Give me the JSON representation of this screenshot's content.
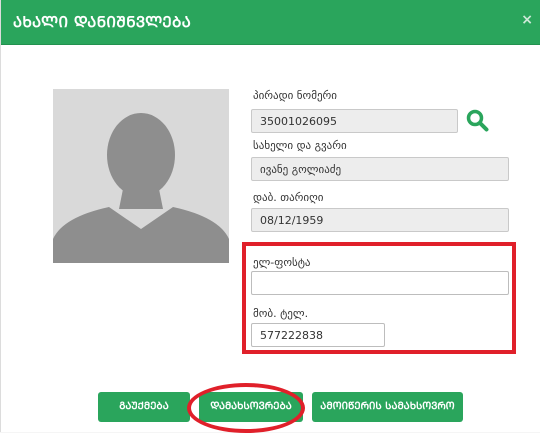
{
  "dialog": {
    "title": "ᲐᲮᲐᲚᲘ ᲓᲐᲜᲘᲨᲜᲕᲚᲔᲑᲐ",
    "close_icon": "×"
  },
  "fields": {
    "personal_number": {
      "label": "პირადი ნომერი",
      "value": "35001026095"
    },
    "full_name": {
      "label": "სახელი და გვარი",
      "value": "ივანე გოლიაძე"
    },
    "birth_date": {
      "label": "დაბ. თარიღი",
      "value": "08/12/1959"
    },
    "email": {
      "label": "ელ-ფოსტა",
      "value": ""
    },
    "mobile": {
      "label": "მობ. ტელ.",
      "value": "577222838"
    }
  },
  "buttons": {
    "cancel": "ᲒᲐᲣᲥᲛᲔᲑᲐ",
    "save": "ᲓᲐᲛᲐᲮᲡᲝᲕᲠᲔᲑᲐ",
    "save_workplace": "ᲐᲛᲝᲘᲬᲔᲠᲘᲡ ᲡᲐᲛᲐᲮᲡᲝᲕᲠᲝ"
  },
  "colors": {
    "header_green": "#2aa55c",
    "button_green": "#2aa55c",
    "highlight_red": "#e0202a",
    "search_icon_green": "#2aa55c"
  },
  "icons": {
    "search": "search-icon",
    "avatar": "avatar-placeholder"
  }
}
